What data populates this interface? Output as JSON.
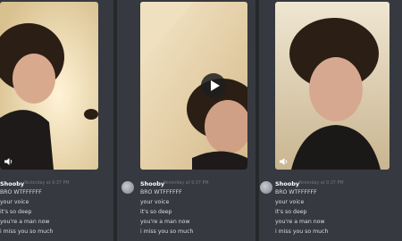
{
  "screens": [
    {
      "username": "Shooby",
      "timestamp": "Yesterday at 9:37 PM",
      "messages": [
        "BRO WTFFFFFF",
        "your voice",
        "it's so deep",
        "you're a man now",
        "i miss you so much"
      ]
    },
    {
      "username": "Shooby",
      "timestamp": "Yesterday at 9:37 PM",
      "messages": [
        "BRO WTFFFFFF",
        "your voice",
        "it's so deep",
        "you're a man now",
        "i miss you so much"
      ]
    },
    {
      "username": "Shooby",
      "timestamp": "Yesterday at 9:37 PM",
      "messages": [
        "BRO WTFFFFFF",
        "your voice",
        "it's so deep",
        "you're a man now",
        "i miss you so much"
      ]
    }
  ],
  "icons": {
    "volume": "volume-icon",
    "play": "play-icon",
    "avatar": "avatar"
  },
  "colors": {
    "background": "#36393f",
    "username": "#ffffff",
    "message_text": "#dcddde",
    "timestamp": "#72767d"
  }
}
